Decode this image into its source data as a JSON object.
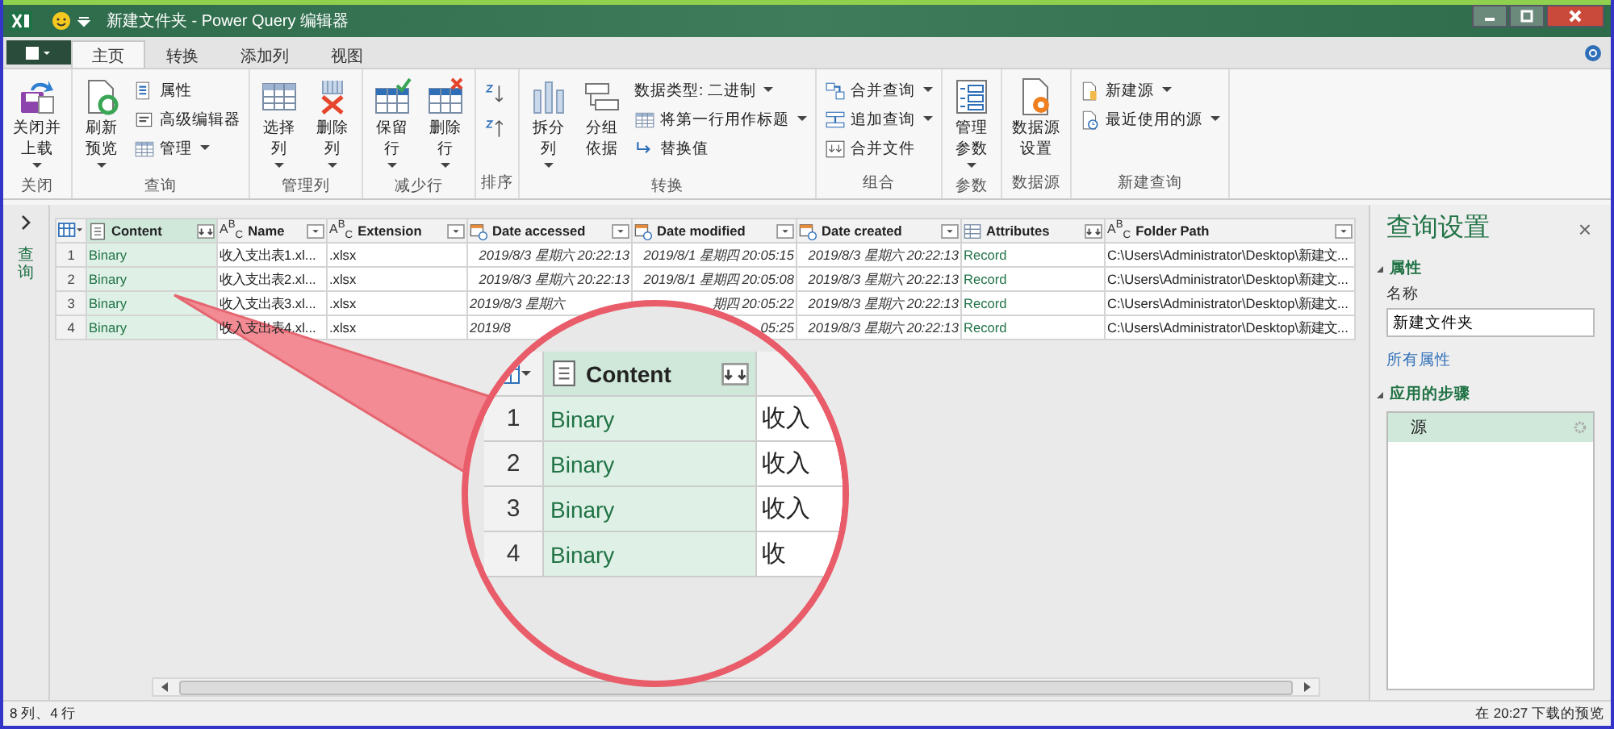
{
  "window": {
    "title": "新建文件夹 - Power Query 编辑器"
  },
  "tabs": [
    {
      "label": "主页",
      "selected": true
    },
    {
      "label": "转换",
      "selected": false
    },
    {
      "label": "添加列",
      "selected": false
    },
    {
      "label": "视图",
      "selected": false
    }
  ],
  "ribbon": {
    "groups": [
      {
        "label": "关闭",
        "buttons": [
          {
            "lines": [
              "关闭并",
              "上载"
            ],
            "kind": "large",
            "dropdown": true
          }
        ]
      },
      {
        "label": "查询",
        "buttons": [
          {
            "lines": [
              "刷新",
              "预览"
            ],
            "kind": "large",
            "dropdown": true
          },
          {
            "lines": [
              "属性"
            ],
            "kind": "small",
            "dropdown": false
          },
          {
            "lines": [
              "高级编辑器"
            ],
            "kind": "small",
            "dropdown": false
          },
          {
            "lines": [
              "管理"
            ],
            "kind": "small",
            "dropdown": true
          }
        ]
      },
      {
        "label": "管理列",
        "buttons": [
          {
            "lines": [
              "选择",
              "列"
            ],
            "kind": "large",
            "dropdown": true
          },
          {
            "lines": [
              "删除",
              "列"
            ],
            "kind": "large",
            "dropdown": true
          }
        ]
      },
      {
        "label": "减少行",
        "buttons": [
          {
            "lines": [
              "保留",
              "行"
            ],
            "kind": "large",
            "dropdown": true
          },
          {
            "lines": [
              "删除",
              "行"
            ],
            "kind": "large",
            "dropdown": true
          }
        ]
      },
      {
        "label": "排序",
        "buttons": [
          {
            "kind": "icon",
            "dropdown": false
          },
          {
            "kind": "icon",
            "dropdown": false
          }
        ]
      },
      {
        "label": "转换",
        "buttons": [
          {
            "lines": [
              "拆分",
              "列"
            ],
            "kind": "large",
            "dropdown": true
          },
          {
            "lines": [
              "分组",
              "依据"
            ],
            "kind": "large",
            "dropdown": false
          },
          {
            "lines": [
              "数据类型: 二进制"
            ],
            "kind": "small",
            "dropdown": true
          },
          {
            "lines": [
              "将第一行用作标题"
            ],
            "kind": "small",
            "dropdown": true
          },
          {
            "lines": [
              "替换值"
            ],
            "kind": "small",
            "dropdown": false
          }
        ]
      },
      {
        "label": "组合",
        "buttons": [
          {
            "lines": [
              "合并查询"
            ],
            "kind": "small",
            "dropdown": true
          },
          {
            "lines": [
              "追加查询"
            ],
            "kind": "small",
            "dropdown": true
          },
          {
            "lines": [
              "合并文件"
            ],
            "kind": "small",
            "dropdown": false
          }
        ]
      },
      {
        "label": "参数",
        "buttons": [
          {
            "lines": [
              "管理",
              "参数"
            ],
            "kind": "large",
            "dropdown": true
          }
        ]
      },
      {
        "label": "数据源",
        "buttons": [
          {
            "lines": [
              "数据源",
              "设置"
            ],
            "kind": "large",
            "dropdown": false
          }
        ]
      },
      {
        "label": "新建查询",
        "buttons": [
          {
            "lines": [
              "新建源"
            ],
            "kind": "small",
            "dropdown": true
          },
          {
            "lines": [
              "最近使用的源"
            ],
            "kind": "small",
            "dropdown": true
          }
        ]
      }
    ]
  },
  "navigator": {
    "label": "查询"
  },
  "table": {
    "columns": [
      {
        "name": "Content",
        "kind": "binary",
        "selected": true
      },
      {
        "name": "Name",
        "kind": "text",
        "type_mark": "A$^{B}$$_{C}$",
        "selected": false
      },
      {
        "name": "Extension",
        "kind": "text",
        "type_mark": "A$^{B}$$_{C}$",
        "selected": false
      },
      {
        "name": "Date accessed",
        "kind": "datetime",
        "selected": false
      },
      {
        "name": "Date modified",
        "kind": "datetime",
        "selected": false
      },
      {
        "name": "Date created",
        "kind": "datetime",
        "selected": false
      },
      {
        "name": "Attributes",
        "kind": "record",
        "selected": false
      },
      {
        "name": "Folder Path",
        "kind": "text",
        "type_mark": "A$^{B}$$_{C}$",
        "selected": false
      }
    ],
    "rows": [
      {
        "index": "1",
        "cells": [
          "Binary",
          "收入支出表1.xl...",
          ".xlsx",
          "2019/8/3 星期六 20:22:13",
          "2019/8/1 星期四 20:05:15",
          "2019/8/3 星期六 20:22:13",
          "Record",
          "C:\\Users\\Administrator\\Desktop\\新建文..."
        ]
      },
      {
        "index": "2",
        "cells": [
          "Binary",
          "收入支出表2.xl...",
          ".xlsx",
          "2019/8/3 星期六 20:22:13",
          "2019/8/1 星期四 20:05:08",
          "2019/8/3 星期六 20:22:13",
          "Record",
          "C:\\Users\\Administrator\\Desktop\\新建文..."
        ]
      },
      {
        "index": "3",
        "cells": [
          "Binary",
          "收入支出表3.xl...",
          ".xlsx",
          {
            "text": "2019/8/3 星期六",
            "kind": "clipped_end"
          },
          {
            "text": "期四 20:05:22",
            "kind": "clipped_start"
          },
          "2019/8/3 星期六 20:22:13",
          "Record",
          "C:\\Users\\Administrator\\Desktop\\新建文..."
        ]
      },
      {
        "index": "4",
        "cells": [
          "Binary",
          "收入支出表4.xl...",
          ".xlsx",
          {
            "text": "2019/8",
            "kind": "clipped_end"
          },
          {
            "text": "05:25",
            "kind": "clipped_start"
          },
          "2019/8/3 星期六 20:22:13",
          "Record",
          "C:\\Users\\Administrator\\Desktop\\新建文..."
        ]
      }
    ]
  },
  "magnifier": {
    "header": "Content",
    "rows": [
      {
        "index": "1",
        "content": "Binary",
        "next": "收入"
      },
      {
        "index": "2",
        "content": "Binary",
        "next": "收入"
      },
      {
        "index": "3",
        "content": "Binary",
        "next": "收入"
      },
      {
        "index": "4",
        "content": "Binary",
        "next": "收"
      }
    ]
  },
  "settings": {
    "title": "查询设置",
    "close": "×",
    "properties_heading": "属性",
    "name_label": "名称",
    "name_value": "新建文件夹",
    "all_properties": "所有属性",
    "steps_heading": "应用的步骤",
    "steps": [
      {
        "label": "源",
        "selected": true
      }
    ]
  },
  "status_bar": {
    "left": "8 列、4 行",
    "right": "在 20:27 下载的预览"
  }
}
